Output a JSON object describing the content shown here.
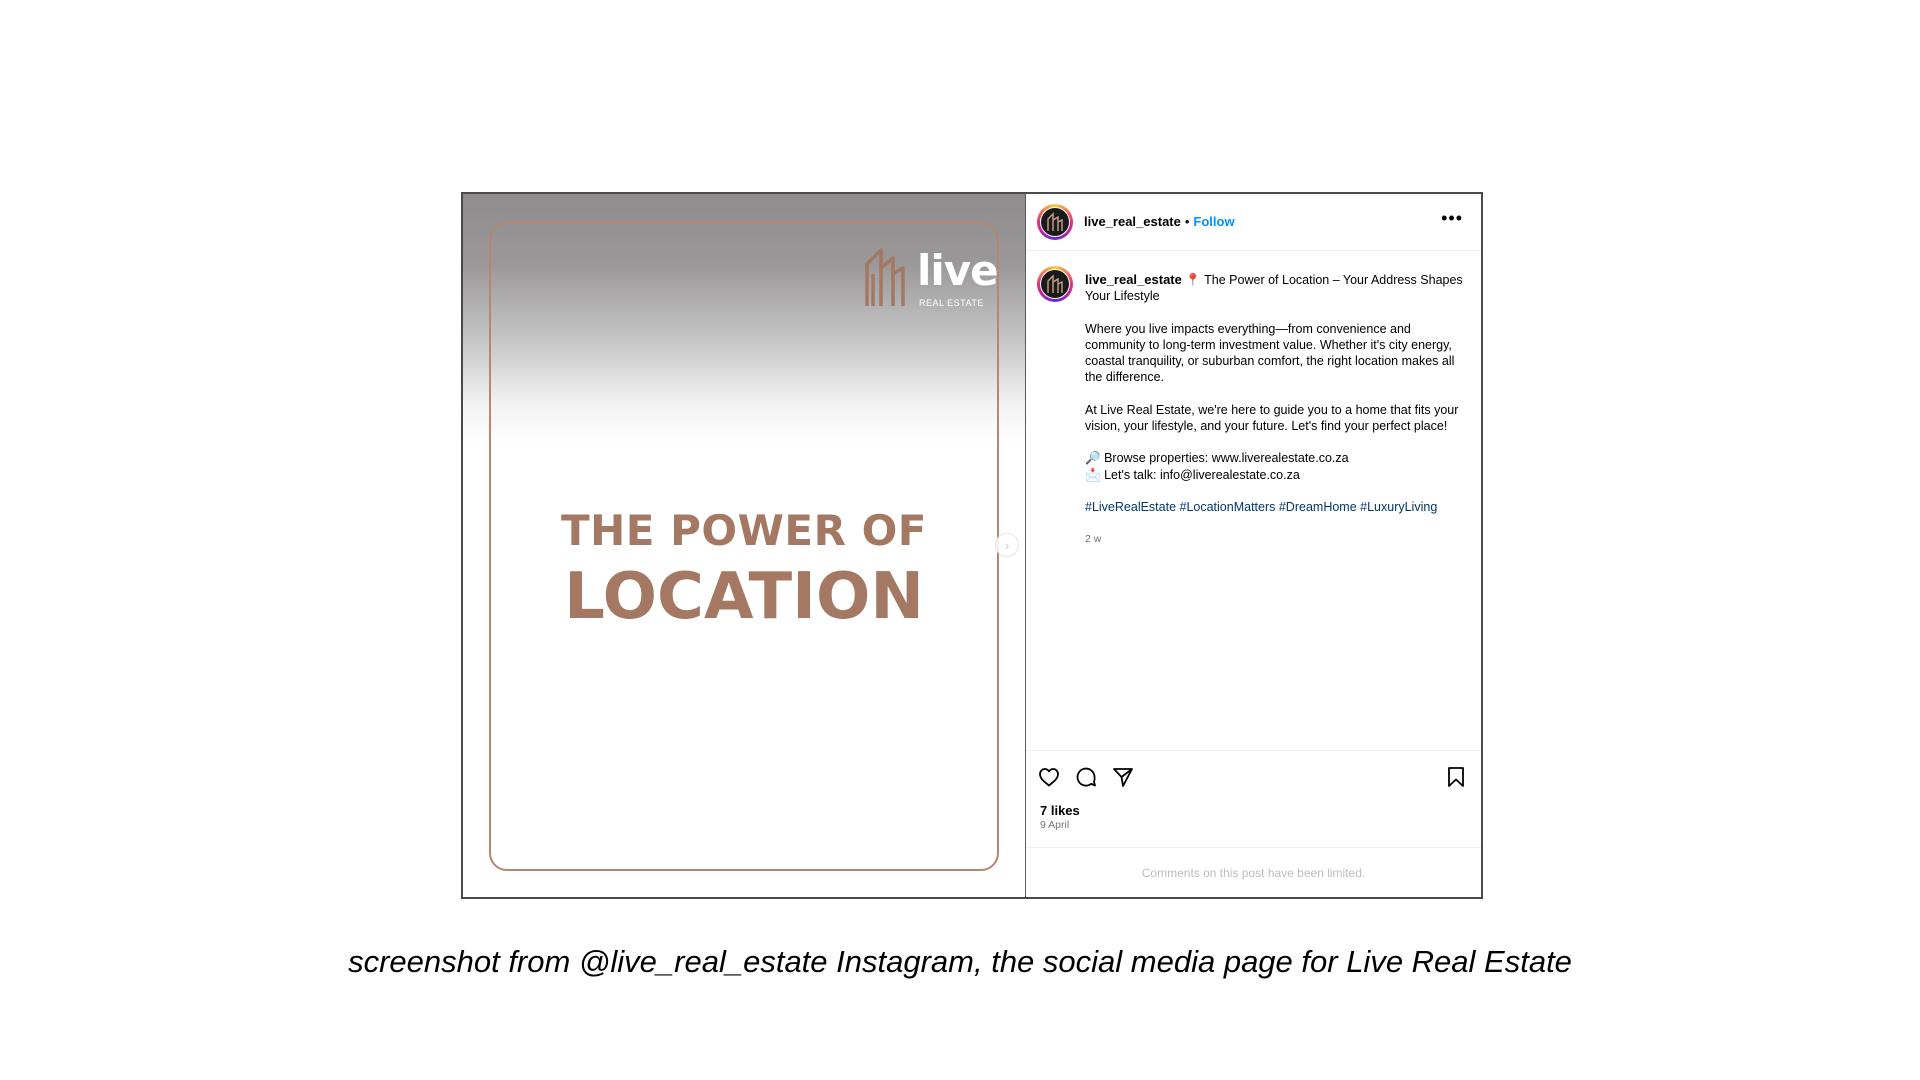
{
  "post_image": {
    "logo_word": "live",
    "logo_sub": "REAL ESTATE",
    "headline_line1": "THE POWER OF",
    "headline_line2": "LOCATION",
    "accent_color": "#a47862"
  },
  "header": {
    "username": "live_real_estate",
    "separator": "•",
    "follow_label": "Follow",
    "more_icon": "more-horizontal-icon"
  },
  "caption": {
    "username": "live_real_estate",
    "title_emoji": "📍",
    "title": "The Power of Location – Your Address Shapes Your Lifestyle",
    "paragraph1": "Where you live impacts everything—from convenience and community to long-term investment value. Whether it's city energy, coastal tranquility, or suburban comfort, the right location makes all the difference.",
    "paragraph2": "At Live Real Estate, we're here to guide you to a home that fits your vision, your lifestyle, and your future. Let's find your perfect place!",
    "browse_emoji": "🔎",
    "browse": "Browse properties: www.liverealestate.co.za",
    "talk_emoji": "📩",
    "talk": "Let's talk: info@liverealestate.co.za",
    "hashtags": "#LiveRealEstate #LocationMatters #DreamHome #LuxuryLiving",
    "time_ago": "2 w"
  },
  "actions": {
    "icons": [
      "heart-icon",
      "comment-icon",
      "share-icon",
      "bookmark-icon"
    ],
    "likes": "7 likes",
    "date": "9 April"
  },
  "comments_limited": "Comments on this post have been limited.",
  "footer_caption": "screenshot from @live_real_estate Instagram, the social media page for Live Real Estate",
  "colors": {
    "follow_blue": "#0095f6",
    "hashtag_blue": "#00376b",
    "border": "#b58670"
  }
}
